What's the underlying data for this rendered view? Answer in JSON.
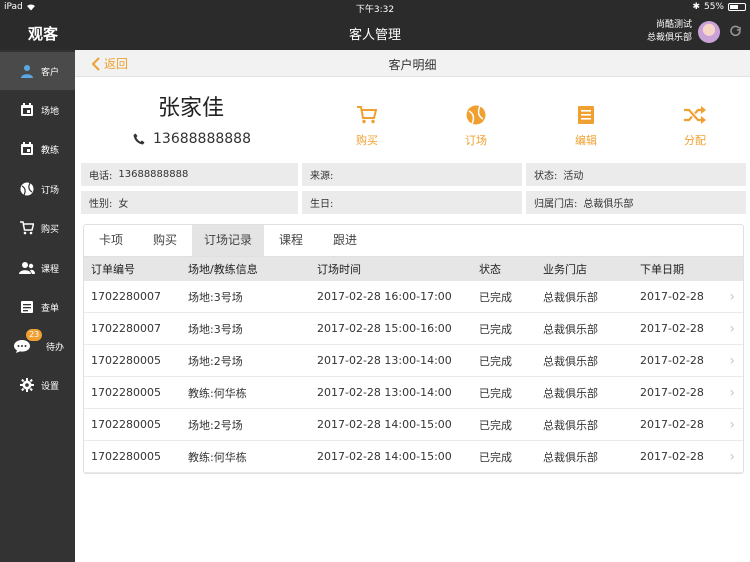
{
  "statusbar": {
    "device": "iPad",
    "time": "下午3:32",
    "battery": "55%"
  },
  "appbar": {
    "app_title": "观客",
    "page_title": "客人管理",
    "user_name": "尚酷测试",
    "user_org": "总裁俱乐部"
  },
  "sidebar": {
    "items": [
      {
        "label": "客户",
        "icon": "person-icon"
      },
      {
        "label": "场地",
        "icon": "calendar-icon"
      },
      {
        "label": "教练",
        "icon": "calendar-icon"
      },
      {
        "label": "订场",
        "icon": "ball-icon"
      },
      {
        "label": "购买",
        "icon": "cart-icon"
      },
      {
        "label": "课程",
        "icon": "group-icon"
      },
      {
        "label": "查单",
        "icon": "list-icon"
      },
      {
        "label": "待办",
        "icon": "chat-icon",
        "badge": "23"
      },
      {
        "label": "设置",
        "icon": "gear-icon"
      }
    ]
  },
  "subheader": {
    "back_label": "返回",
    "title": "客户明细"
  },
  "customer": {
    "name": "张家佳",
    "phone": "13688888888"
  },
  "actions": [
    {
      "label": "购买",
      "icon": "cart-icon"
    },
    {
      "label": "订场",
      "icon": "ball-icon"
    },
    {
      "label": "编辑",
      "icon": "edit-icon"
    },
    {
      "label": "分配",
      "icon": "shuffle-icon"
    }
  ],
  "info": {
    "phone_label": "电话:",
    "phone_value": "13688888888",
    "source_label": "来源:",
    "source_value": "",
    "status_label": "状态:",
    "status_value": "活动",
    "gender_label": "性别:",
    "gender_value": "女",
    "birthday_label": "生日:",
    "birthday_value": "",
    "store_label": "归属门店:",
    "store_value": "总裁俱乐部"
  },
  "tabs": [
    "卡项",
    "购买",
    "订场记录",
    "课程",
    "跟进"
  ],
  "table": {
    "headers": [
      "订单编号",
      "场地/教练信息",
      "订场时间",
      "状态",
      "业务门店",
      "下单日期"
    ],
    "rows": [
      [
        "1702280007",
        "场地:3号场",
        "2017-02-28 16:00-17:00",
        "已完成",
        "总裁俱乐部",
        "2017-02-28"
      ],
      [
        "1702280007",
        "场地:3号场",
        "2017-02-28 15:00-16:00",
        "已完成",
        "总裁俱乐部",
        "2017-02-28"
      ],
      [
        "1702280005",
        "场地:2号场",
        "2017-02-28 13:00-14:00",
        "已完成",
        "总裁俱乐部",
        "2017-02-28"
      ],
      [
        "1702280005",
        "教练:何华栋",
        "2017-02-28 13:00-14:00",
        "已完成",
        "总裁俱乐部",
        "2017-02-28"
      ],
      [
        "1702280005",
        "场地:2号场",
        "2017-02-28 14:00-15:00",
        "已完成",
        "总裁俱乐部",
        "2017-02-28"
      ],
      [
        "1702280005",
        "教练:何华栋",
        "2017-02-28 14:00-15:00",
        "已完成",
        "总裁俱乐部",
        "2017-02-28"
      ]
    ]
  },
  "colors": {
    "accent": "#f0a030",
    "sidebar_bg": "#333333",
    "topbar_bg": "#2b2b2b"
  }
}
